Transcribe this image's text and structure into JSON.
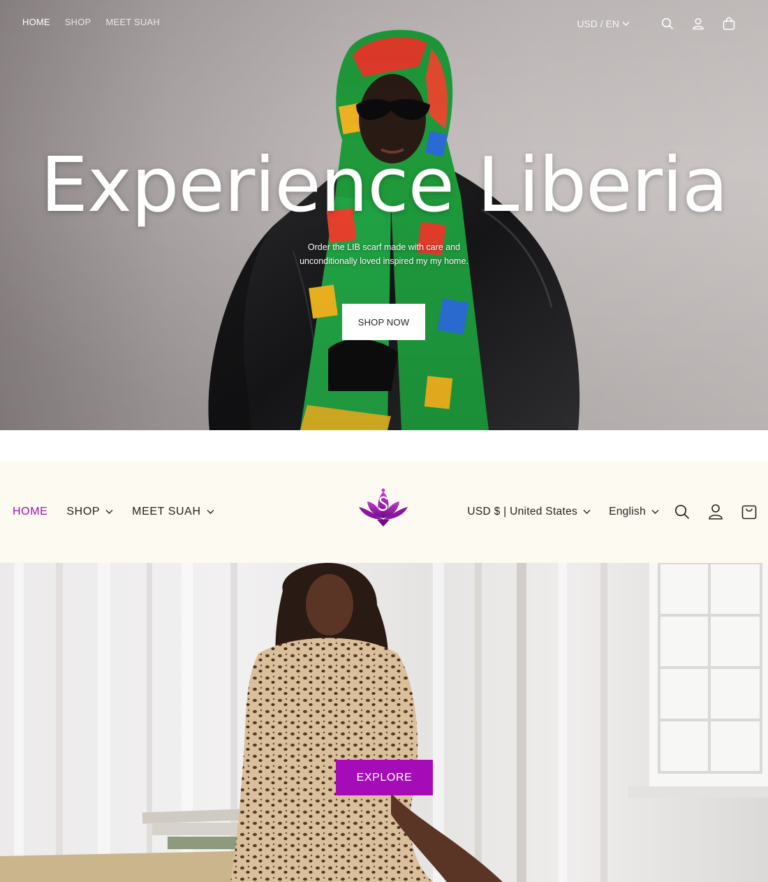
{
  "hero1": {
    "nav": [
      {
        "label": "HOME",
        "active": true
      },
      {
        "label": "SHOP",
        "active": false
      },
      {
        "label": "MEET SUAH",
        "active": false
      }
    ],
    "currency_label": "USD / EN",
    "icons": [
      "search-icon",
      "account-icon",
      "cart-icon"
    ],
    "headline": "Experience Liberia",
    "subtext_line1": "Order the LIB scarf made with care and",
    "subtext_line2": "unconditionally loved inspired my my home.",
    "cta_label": "SHOP NOW"
  },
  "header2": {
    "nav": [
      {
        "label": "HOME",
        "active": true,
        "dropdown": false
      },
      {
        "label": "SHOP",
        "active": false,
        "dropdown": true
      },
      {
        "label": "MEET SUAH",
        "active": false,
        "dropdown": true
      }
    ],
    "logo_icon": "lotus-s-logo-icon",
    "country_currency": "USD $ | United States",
    "language": "English",
    "icons": [
      "search-icon",
      "account-icon",
      "cart-icon"
    ]
  },
  "hero2": {
    "cta_label": "EXPLORE"
  },
  "colors": {
    "accent_purple": "#a50cb8",
    "header_bg": "#fdfaf1",
    "nav_active": "#a010b5"
  }
}
